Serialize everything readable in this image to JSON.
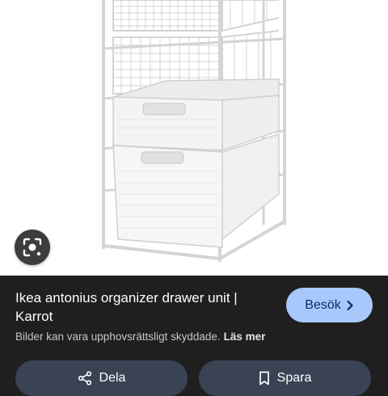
{
  "result": {
    "title": "Ikea antonius organizer drawer unit | Karrot",
    "visit_label": "Besök",
    "copyright_text": "Bilder kan vara upphovsrättsligt skyddade.",
    "learn_more_label": "Läs mer"
  },
  "actions": {
    "share_label": "Dela",
    "save_label": "Spara"
  },
  "icons": {
    "lens": "lens-search-icon",
    "visit": "chevron-right-icon",
    "share": "share-icon",
    "save": "bookmark-icon"
  },
  "colors": {
    "panel_background": "#1f1f1f",
    "visit_button": "#a8c7fa",
    "action_button": "#3a4354"
  }
}
